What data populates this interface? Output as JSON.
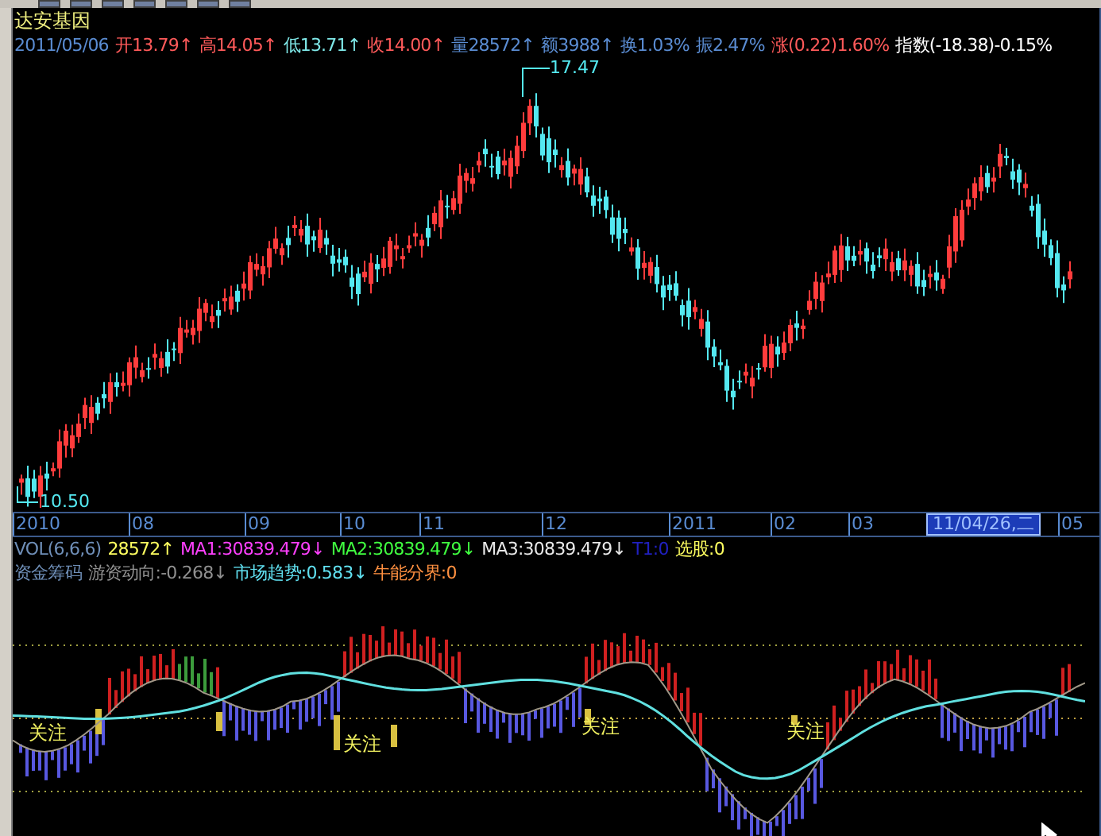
{
  "stock": {
    "name": "达安基因"
  },
  "quote": [
    {
      "text": "2011/05/06",
      "color": "#5a8cd2"
    },
    {
      "text": "开13.79↑",
      "color": "#ff5a5a"
    },
    {
      "text": "高14.05↑",
      "color": "#ff5a5a"
    },
    {
      "text": "低13.71↑",
      "color": "#7fe8e8"
    },
    {
      "text": "收14.00↑",
      "color": "#ff5a5a"
    },
    {
      "text": "量28572↑",
      "color": "#5a8cd2"
    },
    {
      "text": "额3988↑",
      "color": "#5a8cd2"
    },
    {
      "text": "换1.03%",
      "color": "#5a8cd2"
    },
    {
      "text": "振2.47%",
      "color": "#5a8cd2"
    },
    {
      "text": "涨(0.22)1.60%",
      "color": "#ff5a5a"
    },
    {
      "text": "指数(-18.38)-0.15%",
      "color": "#ffffff"
    }
  ],
  "price_chart": {
    "high_label": "17.47",
    "low_label": "10.50"
  },
  "date_axis": {
    "ticks": [
      "2010",
      "08",
      "09",
      "10",
      "11",
      "12",
      "2011",
      "02",
      "03",
      "05"
    ],
    "cursor_date": "11/04/26,二"
  },
  "volume_row": [
    {
      "text": "VOL(6,6,6)",
      "color": "#6f8fb8"
    },
    {
      "text": "28572↑",
      "color": "#ffff60"
    },
    {
      "text": "MA1:30839.479↓",
      "color": "#ff40ff"
    },
    {
      "text": "MA2:30839.479↓",
      "color": "#40ff40"
    },
    {
      "text": "MA3:30839.479↓",
      "color": "#e8e8e8"
    },
    {
      "text": "T1:0",
      "color": "#2020c0"
    },
    {
      "text": "选股:0",
      "color": "#ffff60"
    }
  ],
  "indicator_row": [
    {
      "text": "资金筹码",
      "color": "#6f8fb8"
    },
    {
      "text": "游资动向:-0.268↓",
      "color": "#909090"
    },
    {
      "text": "市场趋势:0.583↓",
      "color": "#60e0f0"
    },
    {
      "text": "牛能分界:0",
      "color": "#ff9040"
    }
  ],
  "markers": [
    "关注",
    "关注",
    "关注",
    "关注"
  ]
}
